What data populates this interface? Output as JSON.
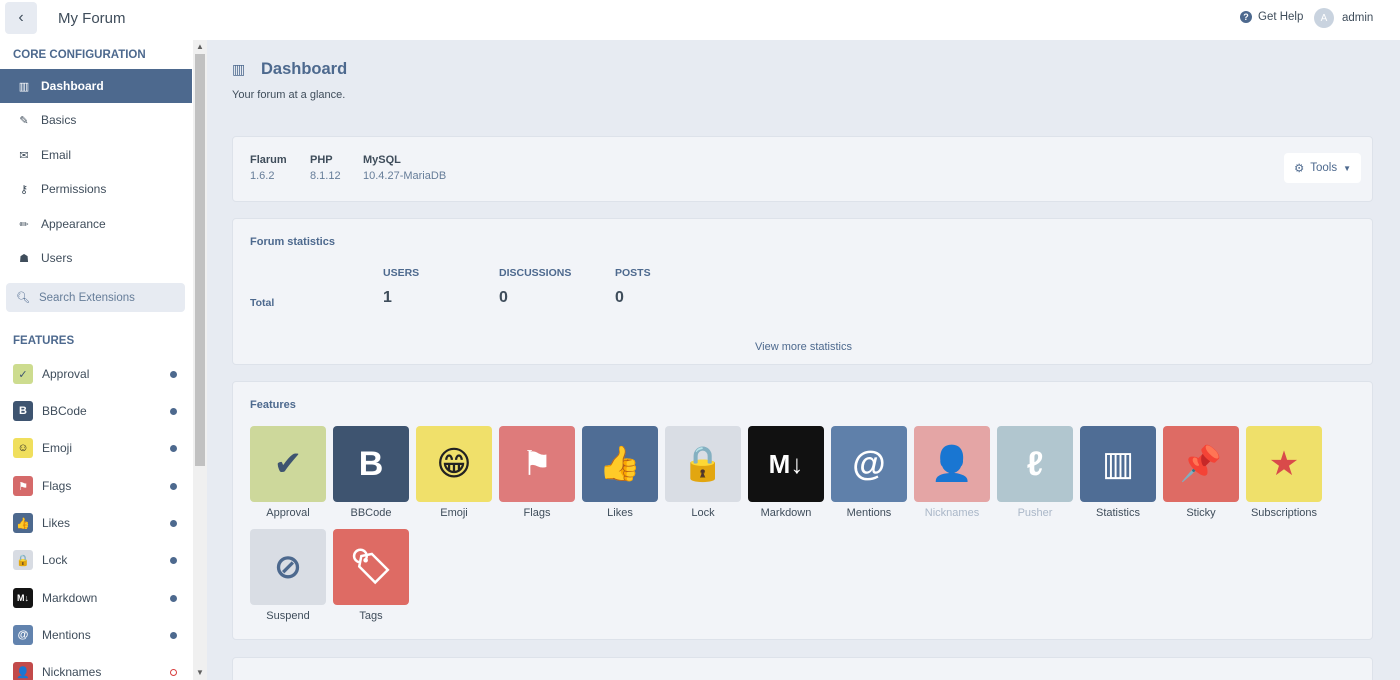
{
  "header": {
    "back_icon": "‹",
    "title": "My Forum",
    "help_label": "Get Help",
    "user_initial": "A",
    "user_name": "admin"
  },
  "sidebar": {
    "core_title": "CORE CONFIGURATION",
    "core_items": [
      {
        "icon": "▥",
        "label": "Dashboard",
        "active": true
      },
      {
        "icon": "✎",
        "label": "Basics"
      },
      {
        "icon": "✉",
        "label": "Email"
      },
      {
        "icon": "⚷",
        "label": "Permissions"
      },
      {
        "icon": "✏",
        "label": "Appearance"
      },
      {
        "icon": "☗",
        "label": "Users"
      }
    ],
    "search_placeholder": "Search Extensions",
    "features_title": "FEATURES",
    "extensions": [
      {
        "label": "Approval",
        "icon": "✓",
        "bg": "#cddc8f",
        "fg": "#3e5470",
        "enabled": true
      },
      {
        "label": "BBCode",
        "icon": "B",
        "bg": "#3e5470",
        "fg": "#fff",
        "enabled": true
      },
      {
        "label": "Emoji",
        "icon": "☺",
        "bg": "#f0df5d",
        "fg": "#222",
        "enabled": true
      },
      {
        "label": "Flags",
        "icon": "⚑",
        "bg": "#d56a6a",
        "fg": "#fff",
        "enabled": true
      },
      {
        "label": "Likes",
        "icon": "👍",
        "bg": "#4d698e",
        "fg": "#fff",
        "enabled": true
      },
      {
        "label": "Lock",
        "icon": "🔒",
        "bg": "#d8dce3",
        "fg": "#4d698e",
        "enabled": true
      },
      {
        "label": "Markdown",
        "icon": "M↓",
        "bg": "#141414",
        "fg": "#fff",
        "enabled": true
      },
      {
        "label": "Mentions",
        "icon": "@",
        "bg": "#6283ae",
        "fg": "#fff",
        "enabled": true
      },
      {
        "label": "Nicknames",
        "icon": "👤",
        "bg": "#c24a4a",
        "fg": "#fff",
        "enabled": false
      }
    ]
  },
  "main": {
    "title_icon": "▥",
    "title": "Dashboard",
    "subtitle": "Your forum at a glance.",
    "versions": [
      {
        "key": "Flarum",
        "value": "1.6.2"
      },
      {
        "key": "PHP",
        "value": "8.1.12"
      },
      {
        "key": "MySQL",
        "value": "10.4.27-MariaDB"
      }
    ],
    "tools_label": "Tools",
    "stats": {
      "title": "Forum statistics",
      "row_label": "Total",
      "columns": [
        {
          "head": "USERS",
          "value": "1"
        },
        {
          "head": "DISCUSSIONS",
          "value": "0"
        },
        {
          "head": "POSTS",
          "value": "0"
        }
      ],
      "view_more": "View more statistics"
    },
    "features": {
      "title": "Features",
      "items": [
        {
          "label": "Approval",
          "icon": "✔",
          "bg": "#cdd89b",
          "fg": "#3e5470",
          "enabled": true
        },
        {
          "label": "BBCode",
          "icon": "B",
          "bg": "#3e5470",
          "fg": "#fff",
          "enabled": true
        },
        {
          "label": "Emoji",
          "icon": "😁",
          "bg": "#f0e06a",
          "fg": "#222",
          "enabled": true
        },
        {
          "label": "Flags",
          "icon": "⚑",
          "bg": "#de7b7b",
          "fg": "#fff",
          "enabled": true
        },
        {
          "label": "Likes",
          "icon": "👍",
          "bg": "#4f6d95",
          "fg": "#fff",
          "enabled": true
        },
        {
          "label": "Lock",
          "icon": "🔒",
          "bg": "#d9dde4",
          "fg": "#4d698e",
          "enabled": true
        },
        {
          "label": "Markdown",
          "icon": "M↓",
          "bg": "#111",
          "fg": "#fff",
          "enabled": true
        },
        {
          "label": "Mentions",
          "icon": "@",
          "bg": "#5f80aa",
          "fg": "#fff",
          "enabled": true
        },
        {
          "label": "Nicknames",
          "icon": "👤",
          "bg": "#e4a5a5",
          "fg": "#fff",
          "enabled": false
        },
        {
          "label": "Pusher",
          "icon": "ℓ",
          "bg": "#b1c6cf",
          "fg": "#fff",
          "enabled": false
        },
        {
          "label": "Statistics",
          "icon": "▥",
          "bg": "#4f6d95",
          "fg": "#fff",
          "enabled": true
        },
        {
          "label": "Sticky",
          "icon": "📌",
          "bg": "#de6b64",
          "fg": "#fff",
          "enabled": true
        },
        {
          "label": "Subscriptions",
          "icon": "★",
          "bg": "#efe06a",
          "fg": "#d94a4a",
          "enabled": true
        },
        {
          "label": "Suspend",
          "icon": "⊘",
          "bg": "#d9dde4",
          "fg": "#4d698e",
          "enabled": true
        },
        {
          "label": "Tags",
          "icon": "🏷",
          "bg": "#de6b64",
          "fg": "#fff",
          "enabled": true
        }
      ]
    }
  }
}
